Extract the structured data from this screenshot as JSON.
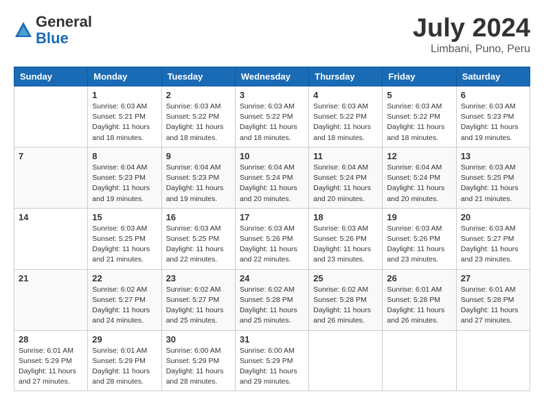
{
  "logo": {
    "general": "General",
    "blue": "Blue"
  },
  "title": {
    "month_year": "July 2024",
    "location": "Limbani, Puno, Peru"
  },
  "weekdays": [
    "Sunday",
    "Monday",
    "Tuesday",
    "Wednesday",
    "Thursday",
    "Friday",
    "Saturday"
  ],
  "weeks": [
    [
      {
        "day": "",
        "info": ""
      },
      {
        "day": "1",
        "info": "Sunrise: 6:03 AM\nSunset: 5:21 PM\nDaylight: 11 hours\nand 18 minutes."
      },
      {
        "day": "2",
        "info": "Sunrise: 6:03 AM\nSunset: 5:22 PM\nDaylight: 11 hours\nand 18 minutes."
      },
      {
        "day": "3",
        "info": "Sunrise: 6:03 AM\nSunset: 5:22 PM\nDaylight: 11 hours\nand 18 minutes."
      },
      {
        "day": "4",
        "info": "Sunrise: 6:03 AM\nSunset: 5:22 PM\nDaylight: 11 hours\nand 18 minutes."
      },
      {
        "day": "5",
        "info": "Sunrise: 6:03 AM\nSunset: 5:22 PM\nDaylight: 11 hours\nand 18 minutes."
      },
      {
        "day": "6",
        "info": "Sunrise: 6:03 AM\nSunset: 5:23 PM\nDaylight: 11 hours\nand 19 minutes."
      }
    ],
    [
      {
        "day": "7",
        "info": ""
      },
      {
        "day": "8",
        "info": "Sunrise: 6:04 AM\nSunset: 5:23 PM\nDaylight: 11 hours\nand 19 minutes."
      },
      {
        "day": "9",
        "info": "Sunrise: 6:04 AM\nSunset: 5:23 PM\nDaylight: 11 hours\nand 19 minutes."
      },
      {
        "day": "10",
        "info": "Sunrise: 6:04 AM\nSunset: 5:24 PM\nDaylight: 11 hours\nand 20 minutes."
      },
      {
        "day": "11",
        "info": "Sunrise: 6:04 AM\nSunset: 5:24 PM\nDaylight: 11 hours\nand 20 minutes."
      },
      {
        "day": "12",
        "info": "Sunrise: 6:04 AM\nSunset: 5:24 PM\nDaylight: 11 hours\nand 20 minutes."
      },
      {
        "day": "13",
        "info": "Sunrise: 6:03 AM\nSunset: 5:25 PM\nDaylight: 11 hours\nand 21 minutes."
      }
    ],
    [
      {
        "day": "14",
        "info": ""
      },
      {
        "day": "15",
        "info": "Sunrise: 6:03 AM\nSunset: 5:25 PM\nDaylight: 11 hours\nand 21 minutes."
      },
      {
        "day": "16",
        "info": "Sunrise: 6:03 AM\nSunset: 5:25 PM\nDaylight: 11 hours\nand 22 minutes."
      },
      {
        "day": "17",
        "info": "Sunrise: 6:03 AM\nSunset: 5:26 PM\nDaylight: 11 hours\nand 22 minutes."
      },
      {
        "day": "18",
        "info": "Sunrise: 6:03 AM\nSunset: 5:26 PM\nDaylight: 11 hours\nand 23 minutes."
      },
      {
        "day": "19",
        "info": "Sunrise: 6:03 AM\nSunset: 5:26 PM\nDaylight: 11 hours\nand 23 minutes."
      },
      {
        "day": "20",
        "info": "Sunrise: 6:03 AM\nSunset: 5:27 PM\nDaylight: 11 hours\nand 23 minutes."
      }
    ],
    [
      {
        "day": "21",
        "info": ""
      },
      {
        "day": "22",
        "info": "Sunrise: 6:02 AM\nSunset: 5:27 PM\nDaylight: 11 hours\nand 24 minutes."
      },
      {
        "day": "23",
        "info": "Sunrise: 6:02 AM\nSunset: 5:27 PM\nDaylight: 11 hours\nand 25 minutes."
      },
      {
        "day": "24",
        "info": "Sunrise: 6:02 AM\nSunset: 5:28 PM\nDaylight: 11 hours\nand 25 minutes."
      },
      {
        "day": "25",
        "info": "Sunrise: 6:02 AM\nSunset: 5:28 PM\nDaylight: 11 hours\nand 26 minutes."
      },
      {
        "day": "26",
        "info": "Sunrise: 6:01 AM\nSunset: 5:28 PM\nDaylight: 11 hours\nand 26 minutes."
      },
      {
        "day": "27",
        "info": "Sunrise: 6:01 AM\nSunset: 5:28 PM\nDaylight: 11 hours\nand 27 minutes."
      }
    ],
    [
      {
        "day": "28",
        "info": "Sunrise: 6:01 AM\nSunset: 5:29 PM\nDaylight: 11 hours\nand 27 minutes."
      },
      {
        "day": "29",
        "info": "Sunrise: 6:01 AM\nSunset: 5:29 PM\nDaylight: 11 hours\nand 28 minutes."
      },
      {
        "day": "30",
        "info": "Sunrise: 6:00 AM\nSunset: 5:29 PM\nDaylight: 11 hours\nand 28 minutes."
      },
      {
        "day": "31",
        "info": "Sunrise: 6:00 AM\nSunset: 5:29 PM\nDaylight: 11 hours\nand 29 minutes."
      },
      {
        "day": "",
        "info": ""
      },
      {
        "day": "",
        "info": ""
      },
      {
        "day": "",
        "info": ""
      }
    ]
  ]
}
